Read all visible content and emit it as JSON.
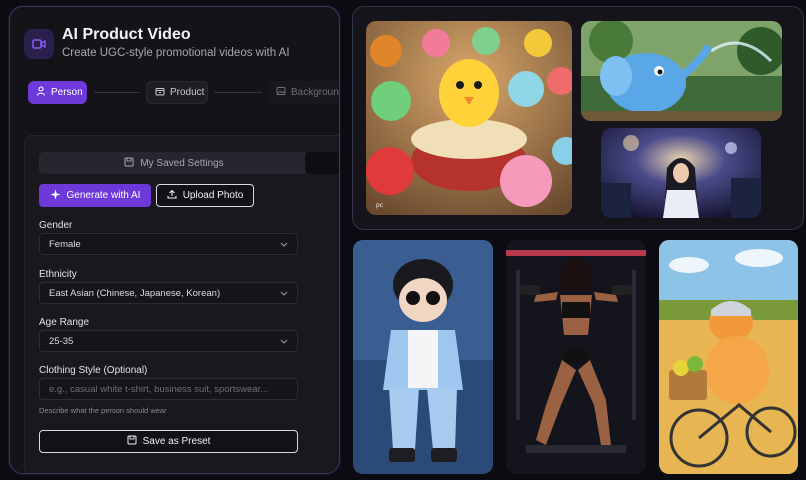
{
  "app": {
    "title": "AI Product Video",
    "subtitle": "Create UGC-style promotional videos with AI"
  },
  "steps": [
    {
      "label": "Person",
      "icon": "person-icon",
      "active": true
    },
    {
      "label": "Product",
      "icon": "package-icon",
      "active": false
    },
    {
      "label": "Background",
      "icon": "image-icon",
      "active": false
    }
  ],
  "form": {
    "saved_settings_label": "My Saved Settings",
    "generate_label": "Generate with AI",
    "upload_label": "Upload Photo",
    "gender": {
      "label": "Gender",
      "value": "Female"
    },
    "ethnicity": {
      "label": "Ethnicity",
      "value": "East Asian (Chinese, Japanese, Korean)"
    },
    "age": {
      "label": "Age Range",
      "value": "25-35"
    },
    "clothing": {
      "label": "Clothing Style (Optional)",
      "placeholder": "e.g., casual white t-shirt, business suit, sportswear...",
      "hint": "Describe what the person should wear"
    },
    "save_preset_label": "Save as Preset"
  },
  "gallery": {
    "watermark": "pc"
  },
  "colors": {
    "accent": "#6d39d9",
    "panel_bg": "#131318",
    "border": "#3a3560"
  }
}
